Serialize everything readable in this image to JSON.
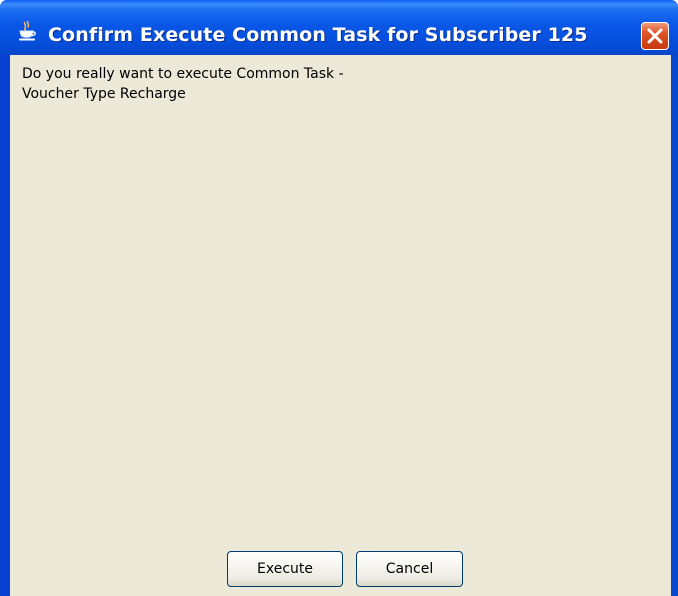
{
  "window": {
    "title": "Confirm Execute Common Task for Subscriber 125",
    "app_icon": "java-cup-icon",
    "close_icon": "close-icon"
  },
  "message": {
    "line1": "Do you really want to execute Common Task -",
    "line2": "Voucher Type Recharge"
  },
  "buttons": {
    "execute_label": "Execute",
    "cancel_label": "Cancel"
  },
  "colors": {
    "titlebar": "#0a58e8",
    "dialog_background": "#ece9d8",
    "close_button": "#d24418",
    "button_border": "#003c74"
  }
}
